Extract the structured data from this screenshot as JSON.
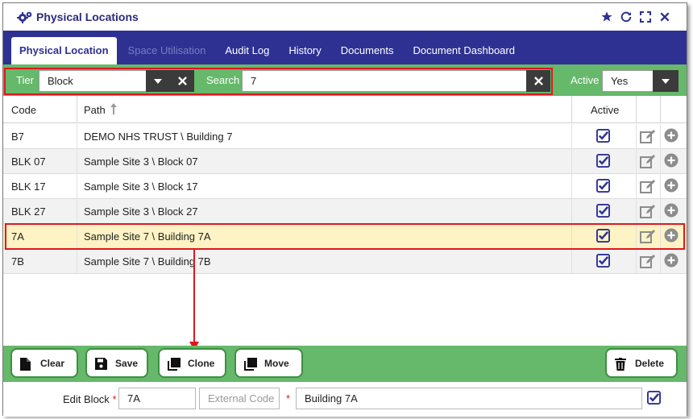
{
  "window": {
    "title": "Physical Locations"
  },
  "title_actions": [
    {
      "name": "favorite-star-icon"
    },
    {
      "name": "refresh-icon"
    },
    {
      "name": "maximize-icon"
    },
    {
      "name": "close-icon"
    }
  ],
  "tabs": [
    {
      "label": "Physical Location",
      "state": "active"
    },
    {
      "label": "Space Utilisation",
      "state": "disabled"
    },
    {
      "label": "Audit Log",
      "state": "normal"
    },
    {
      "label": "History",
      "state": "normal"
    },
    {
      "label": "Documents",
      "state": "normal"
    },
    {
      "label": "Document Dashboard",
      "state": "normal"
    }
  ],
  "filters": {
    "tier_label": "Tier",
    "tier_value": "Block",
    "search_label": "Search",
    "search_value": "7",
    "active_label": "Active",
    "active_value": "Yes"
  },
  "table": {
    "headers": {
      "code": "Code",
      "path": "Path",
      "active": "Active"
    },
    "sort": {
      "column": "Path",
      "direction": "ascending"
    },
    "rows": [
      {
        "code": "B7",
        "path": "DEMO NHS TRUST \\ Building 7",
        "active": true
      },
      {
        "code": "BLK 07",
        "path": "Sample Site 3 \\ Block 07",
        "active": true
      },
      {
        "code": "BLK 17",
        "path": "Sample Site 3 \\ Block 17",
        "active": true
      },
      {
        "code": "BLK 27",
        "path": "Sample Site 3 \\ Block 27",
        "active": true
      },
      {
        "code": "7A",
        "path": "Sample Site 7 \\ Building 7A",
        "active": true,
        "selected": true
      },
      {
        "code": "7B",
        "path": "Sample Site 7 \\ Building 7B",
        "active": true
      }
    ]
  },
  "actions": {
    "clear": "Clear",
    "save": "Save",
    "clone": "Clone",
    "move": "Move",
    "delete": "Delete"
  },
  "edit": {
    "label": "Edit Block",
    "required_mark": "*",
    "code_value": "7A",
    "external_code_placeholder": "External Code",
    "name_value": "Building 7A",
    "active_checked": true
  },
  "colors": {
    "primary": "#2e3192",
    "accent_green": "#66b86a",
    "highlight_red": "#e0161d",
    "selected_row": "#fdf3c4"
  }
}
